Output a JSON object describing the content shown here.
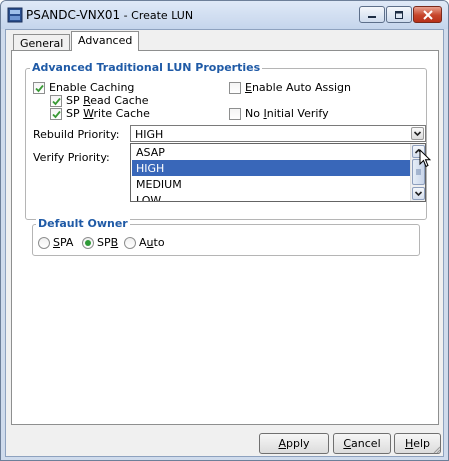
{
  "window": {
    "title": "PSANDC-VNX01",
    "subtitle": " - Create LUN"
  },
  "tabs": [
    {
      "label": "General",
      "active": false
    },
    {
      "label": "Advanced",
      "active": true
    }
  ],
  "advanced_group": {
    "title": "Advanced Traditional LUN Properties",
    "enable_caching": {
      "label": "Enable Caching",
      "checked": true
    },
    "sp_read_cache": {
      "label_prefix": "SP ",
      "label_accel": "R",
      "label_rest": "ead Cache",
      "checked": true
    },
    "sp_write_cache": {
      "label_prefix": "SP ",
      "label_accel": "W",
      "label_rest": "rite Cache",
      "checked": true
    },
    "enable_auto_assign": {
      "label_accel": "E",
      "label_rest": "nable Auto Assign",
      "checked": false
    },
    "no_initial_verify": {
      "label_prefix": "No ",
      "label_accel": "I",
      "label_rest": "nitial Verify",
      "checked": false
    },
    "rebuild_priority": {
      "label": "Rebuild Priority:",
      "value": "HIGH",
      "options": [
        "ASAP",
        "HIGH",
        "MEDIUM",
        "LOW"
      ],
      "selected_option": "HIGH"
    },
    "verify_priority": {
      "label": "Verify Priority:"
    }
  },
  "default_owner": {
    "title": "Default Owner",
    "options": [
      {
        "accel": "S",
        "rest": "PA",
        "selected": false
      },
      {
        "prefix": "SP",
        "accel": "B",
        "rest": "",
        "selected": true
      },
      {
        "prefix": "A",
        "accel": "u",
        "rest": "to",
        "selected": false
      }
    ]
  },
  "buttons": {
    "apply": {
      "accel": "A",
      "rest": "pply"
    },
    "cancel": {
      "accel": "C",
      "rest": "ancel"
    },
    "help": {
      "accel": "H",
      "rest": "elp"
    }
  },
  "colors": {
    "group_title": "#1f5aa6",
    "selection": "#3967b9",
    "radio_dot": "#2e9a37",
    "checkmark": "#3a9a36"
  }
}
